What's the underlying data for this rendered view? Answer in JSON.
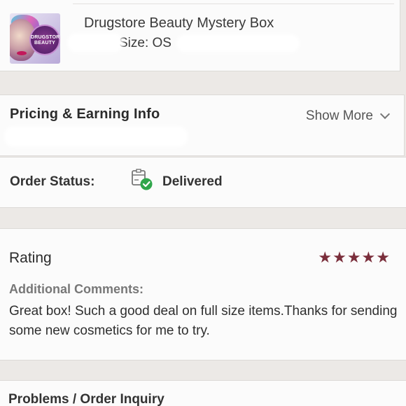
{
  "product": {
    "name": "Drugstore Beauty Mystery Box",
    "size": "Size: OS",
    "thumbnail_text": "DRUGSTORE BEAUTY",
    "thumbnail_icon": "product-thumbnail"
  },
  "pricing": {
    "title": "Pricing & Earning Info",
    "show_more": "Show More",
    "chevron_icon": "chevron-down-icon"
  },
  "order_status": {
    "label": "Order Status:",
    "value": "Delivered",
    "icon": "delivered-package-icon",
    "icon_color": "#2fa64b"
  },
  "rating": {
    "title": "Rating",
    "stars": "★★★★★",
    "star_count": 5,
    "star_color": "#7a2e3b",
    "comments_label": "Additional Comments:",
    "comments_text": "Great box! Such a good deal on full size items.Thanks for sending some new cosmetics for me to try."
  },
  "problems": {
    "title": "Problems / Order Inquiry"
  }
}
